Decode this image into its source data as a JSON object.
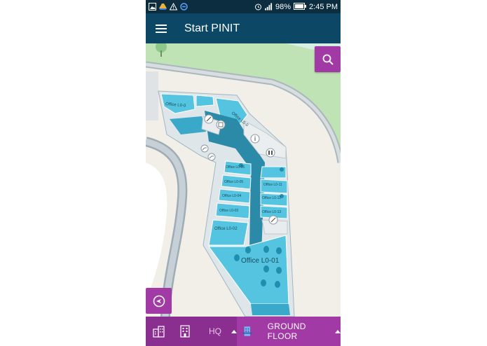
{
  "status_bar": {
    "battery": "98%",
    "time": "2:45 PM"
  },
  "app_bar": {
    "title": "Start PINIT"
  },
  "map": {
    "rooms": {
      "r00a": "Office L0-0",
      "r0a": "Office L0-0",
      "r06": "Office L0-06",
      "r05": "Office L0-05",
      "r04": "Office L0-04",
      "r03": "Office L0-03",
      "r02": "Office L0-02",
      "r01": "Office L0-01",
      "r11": "Office L0-11",
      "r12": "Office L0-12",
      "r13": "Office L0-13"
    }
  },
  "bottom_bar": {
    "building": "HQ",
    "floor": "GROUND FLOOR"
  },
  "colors": {
    "status_bar": "#0c2d3f",
    "app_bar": "#0c4866",
    "accent": "#a23aa6",
    "accent_dark": "#8a2f8f",
    "room": "#54c4e0",
    "corridor": "#2a8aa8"
  }
}
